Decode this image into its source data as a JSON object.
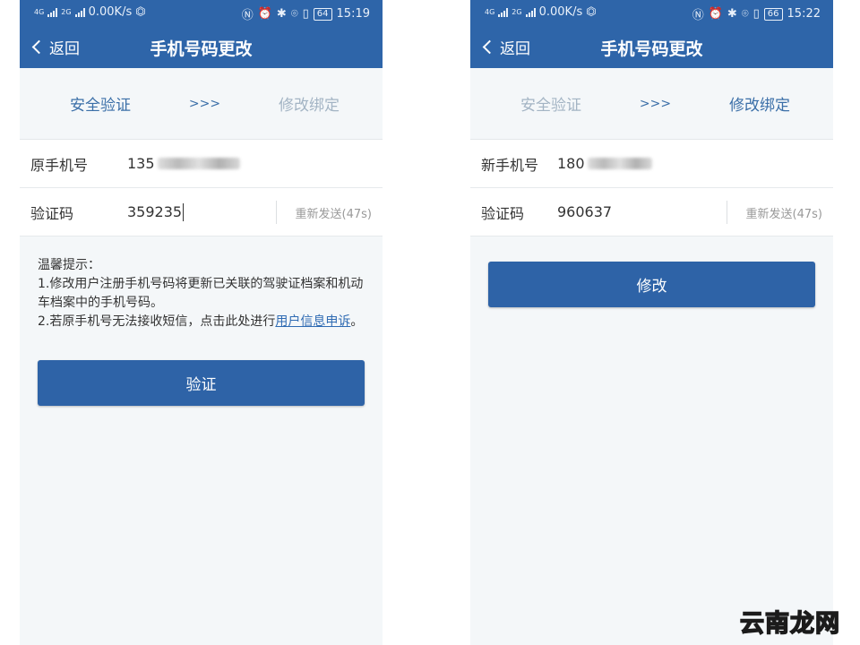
{
  "left": {
    "status": {
      "speed": "0.00K/s",
      "battery": "64",
      "time": "15:19",
      "sim1": "4G",
      "sim2": "2G"
    },
    "nav": {
      "back": "返回",
      "title": "手机号码更改"
    },
    "steps": {
      "step1": "安全验证",
      "arrows": ">>>",
      "step2": "修改绑定"
    },
    "phone_row": {
      "label": "原手机号",
      "value": "135"
    },
    "code_row": {
      "label": "验证码",
      "value": "359235",
      "resend": "重新发送(47s)"
    },
    "tips": {
      "title": "温馨提示：",
      "line1": "1.修改用户注册手机号码将更新已关联的驾驶证档案和机动车档案中的手机号码。",
      "line2_pre": "2.若原手机号无法接收短信，点击此处进行",
      "line2_link": "用户信息申诉",
      "line2_post": "。"
    },
    "button": "验证"
  },
  "right": {
    "status": {
      "speed": "0.00K/s",
      "battery": "66",
      "time": "15:22",
      "sim1": "4G",
      "sim2": "2G"
    },
    "nav": {
      "back": "返回",
      "title": "手机号码更改"
    },
    "steps": {
      "step1": "安全验证",
      "arrows": ">>>",
      "step2": "修改绑定"
    },
    "phone_row": {
      "label": "新手机号",
      "value": "180"
    },
    "code_row": {
      "label": "验证码",
      "value": "960637",
      "resend": "重新发送(47s)"
    },
    "button": "修改"
  },
  "watermark": "云南龙网",
  "colors": {
    "header": "#2e65a9",
    "button": "#2e63a7",
    "step_active": "#3b6fa8",
    "step_inactive": "#a3b4c4",
    "link": "#2f6bb3"
  }
}
